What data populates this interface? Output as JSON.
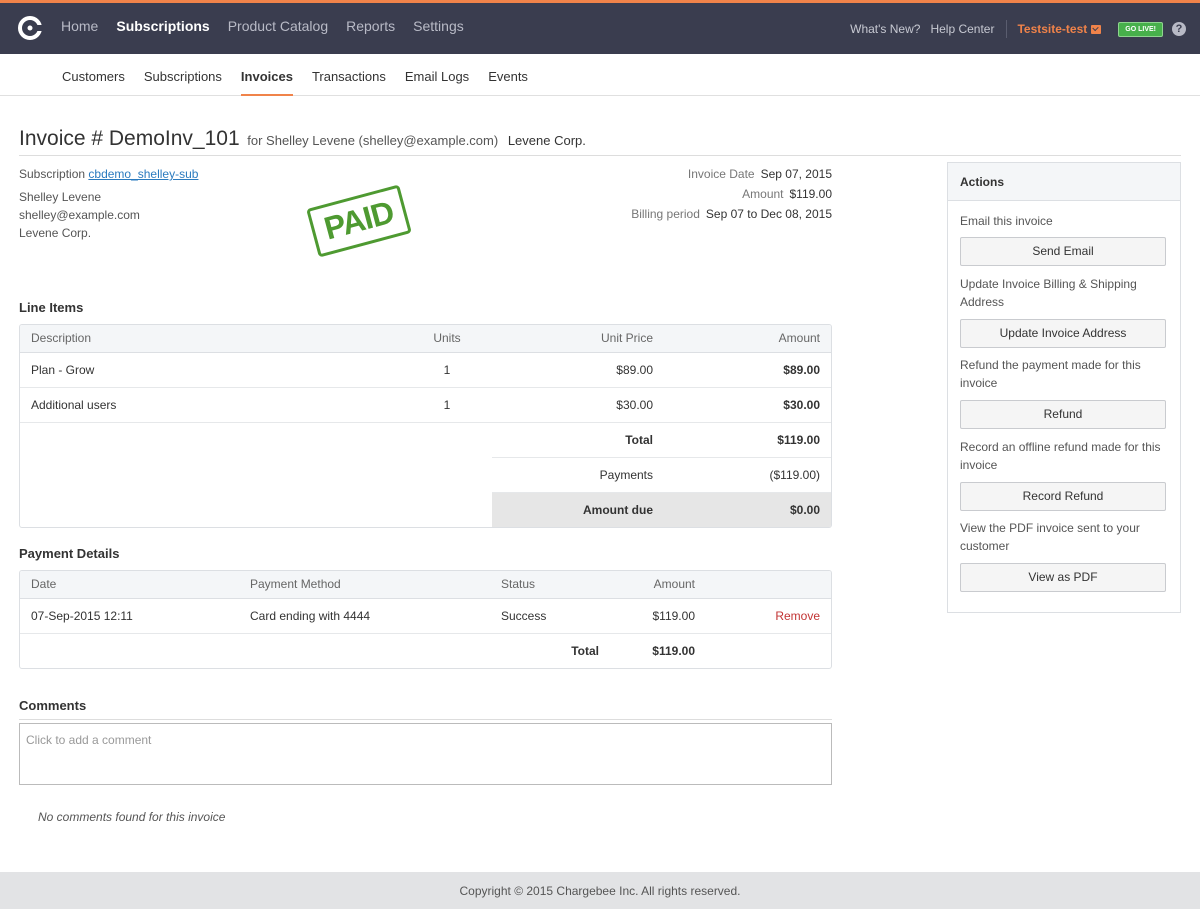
{
  "nav": {
    "items": [
      "Home",
      "Subscriptions",
      "Product Catalog",
      "Reports",
      "Settings"
    ],
    "whats_new": "What's New?",
    "help_center": "Help Center",
    "site": "Testsite-test",
    "go_live": "GO LIVE!",
    "help_icon": "?"
  },
  "subnav": {
    "items": [
      "Customers",
      "Subscriptions",
      "Invoices",
      "Transactions",
      "Email Logs",
      "Events"
    ]
  },
  "invoice": {
    "title": "Invoice # DemoInv_101",
    "for_text": "for Shelley Levene (shelley@example.com)",
    "company": "Levene Corp.",
    "subscription_label": "Subscription",
    "subscription_link": "cbdemo_shelley-sub",
    "customer_name": "Shelley Levene",
    "customer_email": "shelley@example.com",
    "customer_company": "Levene Corp.",
    "stamp": "PAID",
    "date_label": "Invoice Date",
    "date": "Sep 07, 2015",
    "amount_label": "Amount",
    "amount": "$119.00",
    "period_label": "Billing period",
    "period": "Sep 07 to Dec 08, 2015"
  },
  "line_items": {
    "heading": "Line Items",
    "headers": [
      "Description",
      "Units",
      "Unit Price",
      "Amount"
    ],
    "rows": [
      {
        "description": "Plan - Grow",
        "units": "1",
        "unit_price": "$89.00",
        "amount": "$89.00"
      },
      {
        "description": "Additional users",
        "units": "1",
        "unit_price": "$30.00",
        "amount": "$30.00"
      }
    ],
    "total_label": "Total",
    "total": "$119.00",
    "payments_label": "Payments",
    "payments": "($119.00)",
    "due_label": "Amount due",
    "due": "$0.00"
  },
  "payments": {
    "heading": "Payment Details",
    "headers": [
      "Date",
      "Payment Method",
      "Status",
      "Amount"
    ],
    "row": {
      "date": "07-Sep-2015 12:11",
      "method": "Card ending with 4444",
      "status": "Success",
      "amount": "$119.00",
      "action": "Remove"
    },
    "total_label": "Total",
    "total": "$119.00"
  },
  "actions": {
    "heading": "Actions",
    "items": [
      {
        "text": "Email this invoice",
        "button": "Send Email"
      },
      {
        "text": "Update Invoice Billing & Shipping Address",
        "button": "Update Invoice Address"
      },
      {
        "text": "Refund the payment made for this invoice",
        "button": "Refund"
      },
      {
        "text": "Record an offline refund made for this invoice",
        "button": "Record Refund"
      },
      {
        "text": "View the PDF invoice sent to your customer",
        "button": "View as PDF"
      }
    ]
  },
  "comments": {
    "heading": "Comments",
    "placeholder": "Click to add a comment",
    "empty": "No comments found for this invoice"
  },
  "footer": "Copyright © 2015 Chargebee Inc. All rights reserved.",
  "colors": {
    "accent": "#f0834a",
    "topbar": "#3a3d4f",
    "paid": "#4e9a31",
    "link": "#2b7bbf",
    "remove": "#c23434"
  }
}
